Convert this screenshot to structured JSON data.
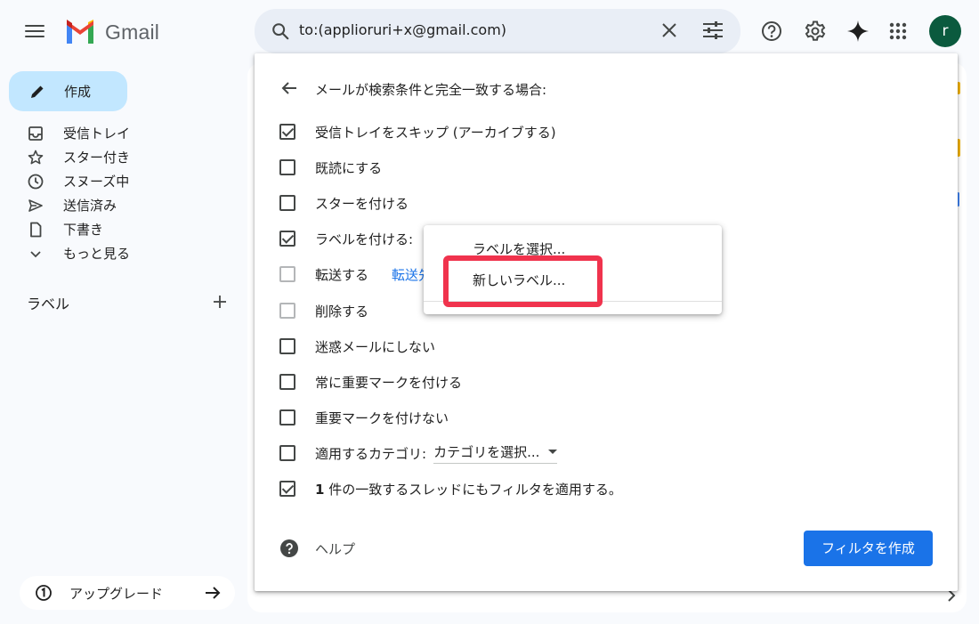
{
  "header": {
    "app_name": "Gmail",
    "search_value": "to:(applioruri+x@gmail.com)",
    "avatar_letter": "r"
  },
  "sidebar": {
    "compose_label": "作成",
    "items": [
      {
        "label": "受信トレイ",
        "icon": "inbox-icon"
      },
      {
        "label": "スター付き",
        "icon": "star-icon"
      },
      {
        "label": "スヌーズ中",
        "icon": "clock-icon"
      },
      {
        "label": "送信済み",
        "icon": "send-icon"
      },
      {
        "label": "下書き",
        "icon": "draft-icon"
      },
      {
        "label": "もっと見る",
        "icon": "chevron-down-icon"
      }
    ],
    "labels_title": "ラベル",
    "upgrade_label": "アップグレード"
  },
  "filter": {
    "heading": "メールが検索条件と完全一致する場合:",
    "options": {
      "skip_inbox": "受信トレイをスキップ (アーカイブする)",
      "mark_read": "既読にする",
      "star": "スターを付ける",
      "apply_label": "ラベルを付ける:",
      "forward": "転送する",
      "forward_link": "転送先",
      "delete": "削除する",
      "never_spam": "迷惑メールにしない",
      "always_important": "常に重要マークを付ける",
      "never_important": "重要マークを付けない",
      "category": "適用するカテゴリ:",
      "category_select": "カテゴリを選択...",
      "apply_matching_bold": "1",
      "apply_matching": " 件の一致するスレッドにもフィルタを適用する。"
    },
    "checked": {
      "skip_inbox": true,
      "mark_read": false,
      "star": false,
      "apply_label": true,
      "forward": false,
      "delete": false,
      "never_spam": false,
      "always_important": false,
      "never_important": false,
      "category": false,
      "apply_matching": true
    },
    "help_label": "ヘルプ",
    "create_button": "フィルタを作成"
  },
  "label_dropdown": {
    "choose_label": "ラベルを選択...",
    "new_label": "新しいラベル..."
  },
  "colors": {
    "compose_bg": "#c2e7ff",
    "primary_blue": "#1a73e8",
    "highlight_red": "#f0334d",
    "avatar_bg": "#0b5a3e"
  }
}
